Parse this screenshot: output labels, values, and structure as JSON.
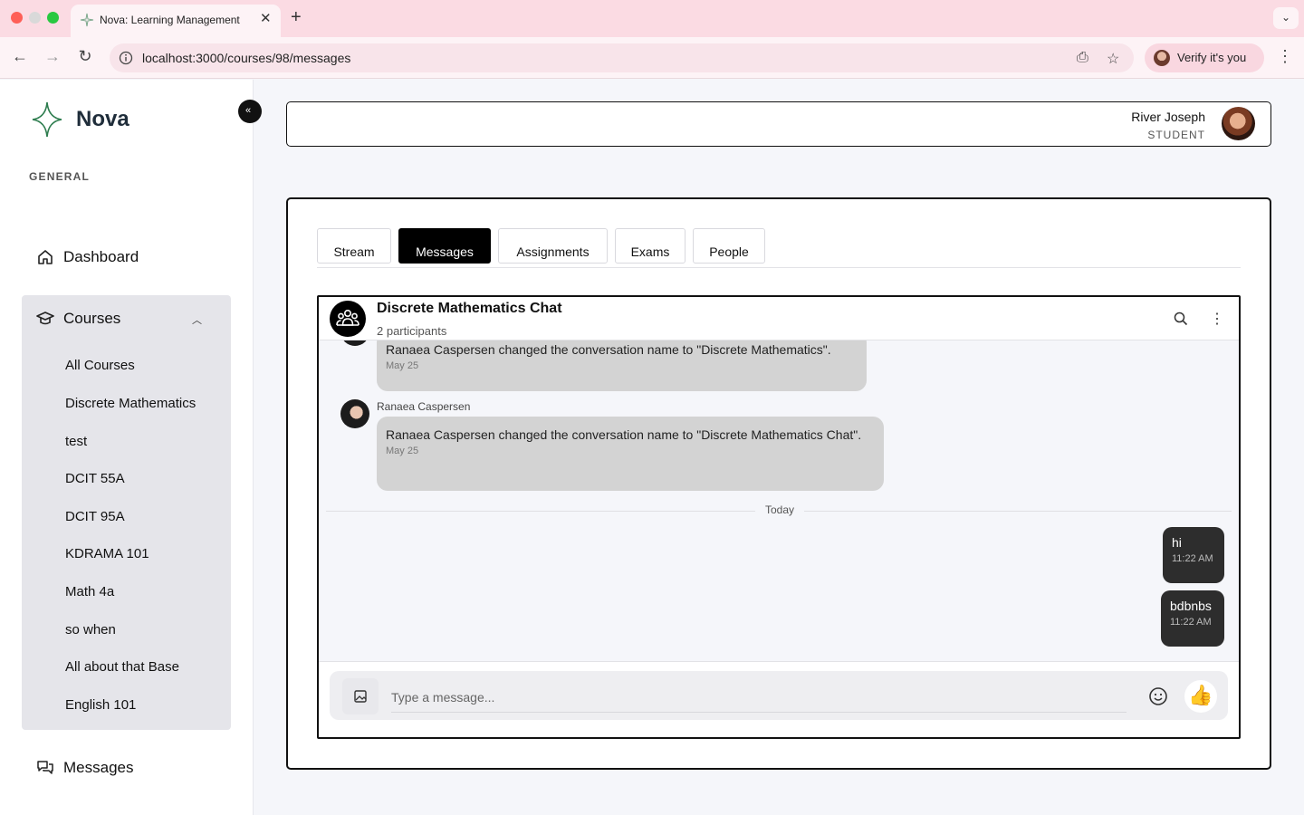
{
  "browser": {
    "tab_title": "Nova: Learning Management",
    "url": "localhost:3000/courses/98/messages",
    "verify_label": "Verify it's you"
  },
  "sidebar": {
    "app_name": "Nova",
    "section": "GENERAL",
    "dashboard": "Dashboard",
    "courses": "Courses",
    "course_links": [
      "All Courses",
      "Discrete Mathematics",
      "test",
      "DCIT 55A",
      "DCIT 95A",
      "KDRAMA 101",
      "Math 4a",
      "so when",
      "All about that Base",
      "English 101"
    ],
    "messages": "Messages"
  },
  "user": {
    "name": "River Joseph",
    "role": "STUDENT"
  },
  "course_tabs": [
    "Stream",
    "Messages",
    "Assignments",
    "Exams",
    "People"
  ],
  "active_tab": "Messages",
  "chat": {
    "title": "Discrete Mathematics Chat",
    "participants": "2 participants",
    "messages": [
      {
        "sender": "",
        "text": "Ranaea Caspersen changed the conversation name to \"Discrete Mathematics\".",
        "time": "May 25"
      },
      {
        "sender": "Ranaea Caspersen",
        "text": "Ranaea Caspersen changed the conversation name to \"Discrete Mathematics Chat\".",
        "time": "May 25"
      }
    ],
    "divider": "Today",
    "own_messages": [
      {
        "text": "hi",
        "time": "11:22 AM"
      },
      {
        "text": "bdbnbs",
        "time": "11:22 AM"
      }
    ],
    "input_placeholder": "Type a message...",
    "like_emoji": "👍"
  },
  "colors": {
    "accent": "#000000",
    "tabbar": "#fbdbe3",
    "sidebar_panel": "#e5e5ea",
    "logo": "#2e7d4f"
  }
}
